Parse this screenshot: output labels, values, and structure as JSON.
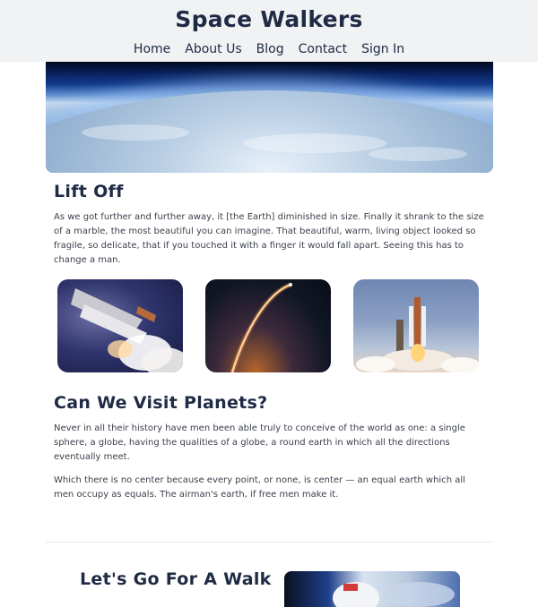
{
  "header": {
    "title": "Space Walkers",
    "nav": [
      "Home",
      "About Us",
      "Blog",
      "Contact",
      "Sign In"
    ]
  },
  "hero": {
    "image": "earth-from-space-image"
  },
  "lift_off": {
    "title": "Lift Off",
    "text": "As we got further and further away, it [the Earth] diminished in size. Finally it shrank to the size of a marble, the most beautiful you can imagine. That beautiful, warm, living object looked so fragile, so delicate, that if you touched it with a finger it would fall apart. Seeing this has to change a man."
  },
  "gallery": [
    "space-shuttle-boosters-image",
    "rocket-launch-trail-image",
    "shuttle-launch-pad-image"
  ],
  "visit": {
    "title": "Can We Visit Planets?",
    "p1": "Never in all their history have men been able truly to conceive of the world as one: a single sphere, a globe, having the qualities of a globe, a round earth in which all the directions eventually meet.",
    "p2": "Which there is no center because every point, or none, is center — an equal earth which all men occupy as equals. The airman's earth, if free men make it."
  },
  "walk": {
    "title": "Let's Go For A Walk",
    "image": "spacewalk-image"
  }
}
